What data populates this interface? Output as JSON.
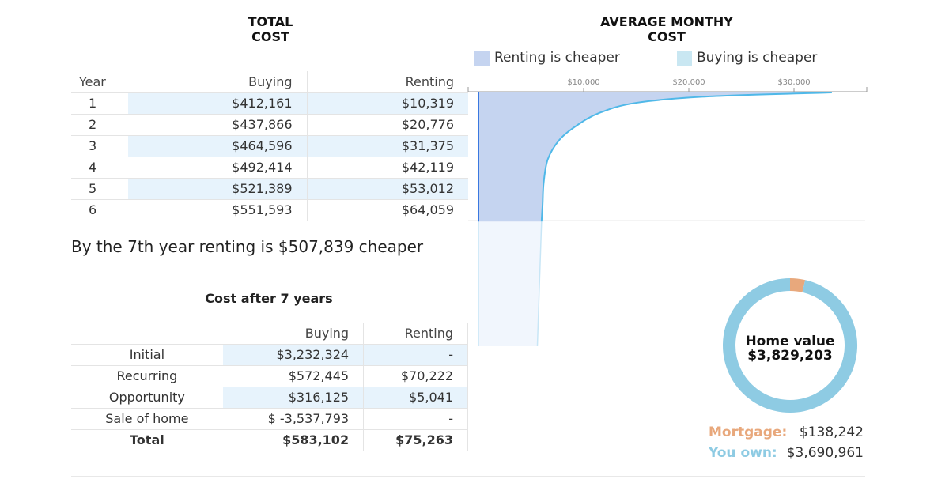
{
  "headers": {
    "total_cost": "TOTAL COST",
    "average_monthly_cost": "AVERAGE MONTHY COST"
  },
  "legend": {
    "renting": {
      "label": "Renting is cheaper",
      "color": "#c5d4f0"
    },
    "buying": {
      "label": "Buying is cheaper",
      "color": "#c9e7f2"
    }
  },
  "year_table": {
    "columns": [
      "Year",
      "Buying",
      "Renting"
    ],
    "rows": [
      {
        "year": "1",
        "buying": "$412,161",
        "renting": "$10,319"
      },
      {
        "year": "2",
        "buying": "$437,866",
        "renting": "$20,776"
      },
      {
        "year": "3",
        "buying": "$464,596",
        "renting": "$31,375"
      },
      {
        "year": "4",
        "buying": "$492,414",
        "renting": "$42,119"
      },
      {
        "year": "5",
        "buying": "$521,389",
        "renting": "$53,012"
      },
      {
        "year": "6",
        "buying": "$551,593",
        "renting": "$64,059"
      }
    ]
  },
  "summary": "By the 7th year renting is $507,839 cheaper",
  "cost_table": {
    "title": "Cost after 7 years",
    "columns": [
      "",
      "Buying",
      "Renting"
    ],
    "rows": [
      {
        "label": "Initial",
        "buying": "$3,232,324",
        "renting": "-"
      },
      {
        "label": "Recurring",
        "buying": "$572,445",
        "renting": "$70,222"
      },
      {
        "label": "Opportunity",
        "buying": "$316,125",
        "renting": "$5,041"
      },
      {
        "label": "Sale of home",
        "buying": "$ -3,537,793",
        "renting": "-"
      },
      {
        "label": "Total",
        "buying": "$583,102",
        "renting": "$75,263"
      }
    ]
  },
  "chart_data": [
    {
      "type": "area",
      "title": "AVERAGE MONTHY COST",
      "x_axis": {
        "min": 0,
        "max": 35000,
        "ticks": [
          10000,
          20000,
          30000
        ],
        "tick_labels": [
          "$10,000",
          "$20,000",
          "$30,000"
        ],
        "position": "top"
      },
      "y_axis": {
        "label": "Year",
        "min": 0,
        "max": 6
      },
      "series": [
        {
          "name": "Renting is cheaper",
          "color": "#c5d4f0",
          "line_color": "#4fb8e8",
          "points": [
            {
              "year": 0.0,
              "monthly_cost": 33600
            },
            {
              "year": 0.18,
              "monthly_cost": 22000
            },
            {
              "year": 0.48,
              "monthly_cost": 15000
            },
            {
              "year": 0.95,
              "monthly_cost": 11500
            },
            {
              "year": 1.55,
              "monthly_cost": 9300
            },
            {
              "year": 2.2,
              "monthly_cost": 7700
            },
            {
              "year": 3.1,
              "monthly_cost": 6600
            },
            {
              "year": 4.2,
              "monthly_cost": 6200
            },
            {
              "year": 5.2,
              "monthly_cost": 6100
            },
            {
              "year": 6.0,
              "monthly_cost": 6000
            }
          ]
        },
        {
          "name": "Renting",
          "color": "#f1f6fd",
          "line_color": "#c8e6f6",
          "points": [
            {
              "year": 6.0,
              "monthly_cost": 6000
            },
            {
              "year": 11.8,
              "monthly_cost": 5600
            }
          ]
        }
      ],
      "marker_line_color": "#3a78e0",
      "legend": "top"
    },
    {
      "type": "pie",
      "title": "Home value",
      "total": "$3,829,203",
      "slices": [
        {
          "label": "Mortgage:",
          "value": 138242,
          "display": "$138,242",
          "color": "#e8a87c"
        },
        {
          "label": "You own:",
          "value": 3690961,
          "display": "$3,690,961",
          "color": "#8ecbe3"
        }
      ]
    }
  ]
}
